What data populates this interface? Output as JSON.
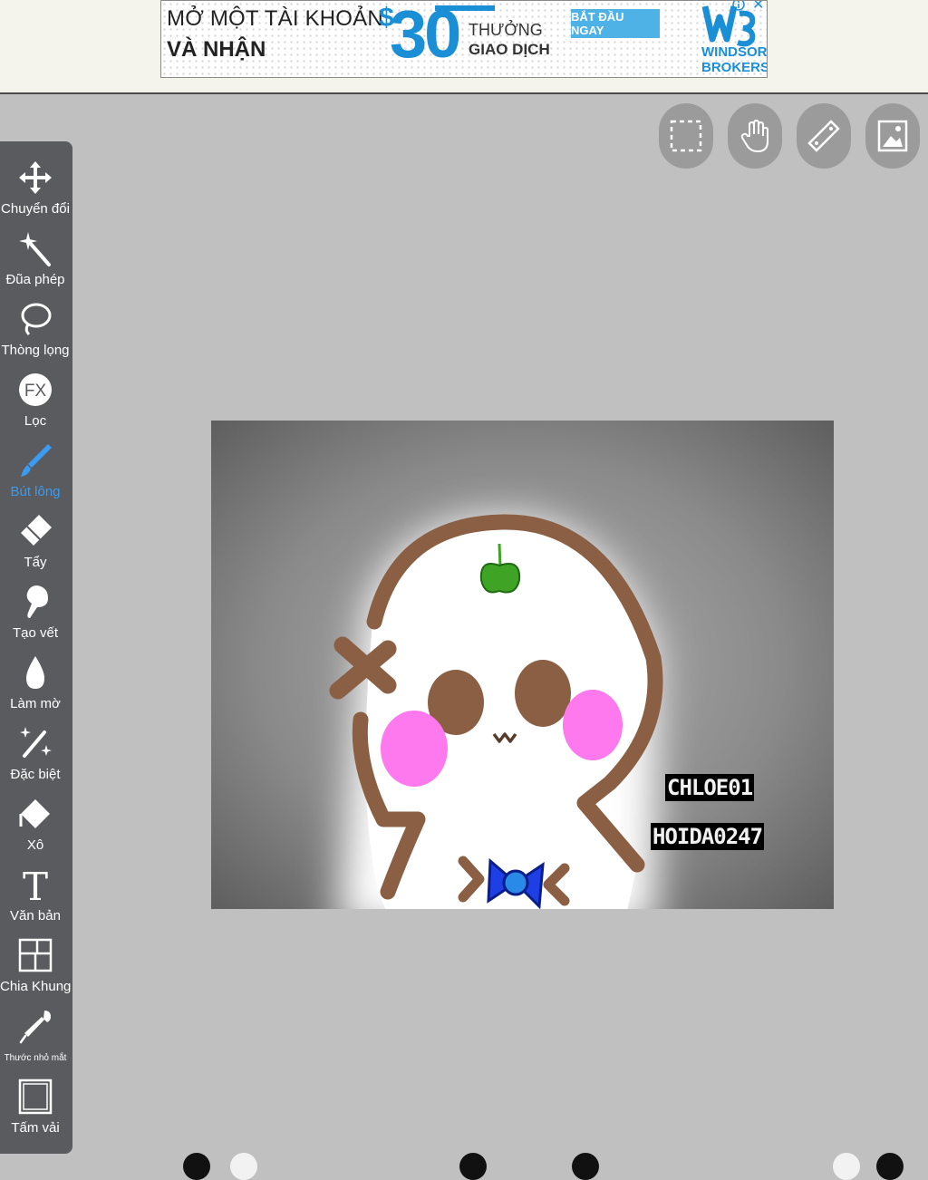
{
  "ad": {
    "line1": "MỞ MỘT TÀI KHOẢN",
    "line2": "VÀ NHẬN",
    "currency": "$",
    "amount": "30",
    "bonus_line1": "THƯỞNG",
    "bonus_line2": "GIAO DỊCH",
    "cta": "BẮT ĐẦU NGAY",
    "brand_line1": "WINDSOR",
    "brand_line2": "BROKERS",
    "close": "✕",
    "accent_color": "#1b8fd6"
  },
  "toolbar": {
    "active_color": "#3a9bf0",
    "items": [
      {
        "label": "Chuyển đổi",
        "icon": "move-icon"
      },
      {
        "label": "Đũa phép",
        "icon": "magic-wand-icon"
      },
      {
        "label": "Thòng lọng",
        "icon": "lasso-icon"
      },
      {
        "label": "FX",
        "icon": "fx-icon"
      },
      {
        "label": "Lọc",
        "icon": "filter-icon"
      },
      {
        "label": "Bút lông",
        "icon": "brush-icon",
        "active": true
      },
      {
        "label": "Tẩy",
        "icon": "eraser-icon"
      },
      {
        "label": "Tạo vết",
        "icon": "smudge-icon"
      },
      {
        "label": "Làm mờ",
        "icon": "blur-icon"
      },
      {
        "label": "Đặc biệt",
        "icon": "special-icon"
      },
      {
        "label": "Xô",
        "icon": "bucket-icon"
      },
      {
        "label": "T",
        "icon": "text-icon"
      },
      {
        "label": "Văn bản",
        "icon": "text-icon"
      },
      {
        "label": "Chia Khung",
        "icon": "frame-divider-icon"
      },
      {
        "label": "Thước nhỏ mắt",
        "icon": "eyedropper-icon"
      },
      {
        "label": "Tấm vải",
        "icon": "canvas-icon"
      }
    ]
  },
  "top_buttons": [
    {
      "icon": "selection-icon"
    },
    {
      "icon": "hand-icon"
    },
    {
      "icon": "ruler-icon"
    },
    {
      "icon": "layers-icon"
    }
  ],
  "canvas": {
    "watermark1": "CHLOE01",
    "watermark2": "HOIDA0247",
    "background_color": "#7a7a7a",
    "outline_color": "#8a5f44",
    "cheek_color": "#ff79ee",
    "leaf_color": "#3fa325",
    "bow_color": "#1e3fe6"
  }
}
